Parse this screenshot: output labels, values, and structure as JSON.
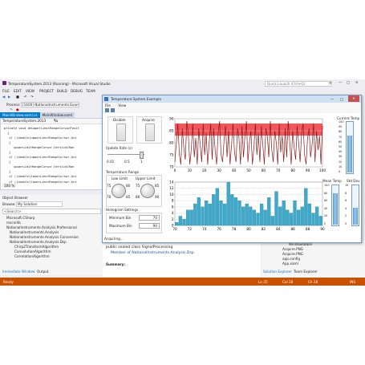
{
  "vs": {
    "title": "TemperatureSystem.2013 (Running) - Microsoft Visual Studio",
    "quick_launch": "Quick Launch (Ctrl+Q)",
    "menu": [
      "FILE",
      "EDIT",
      "VIEW",
      "PROJECT",
      "BUILD",
      "DEBUG",
      "TEAM"
    ],
    "process_label": "Process:",
    "process_value": "[1600] NationalInstruments.Example",
    "tabs": [
      "MainWindow.xaml.cs",
      "MainWindow.xaml"
    ],
    "class_dropdown": "TemperatureSystem.2013",
    "member_dropdown": "¶a",
    "code": [
      "private void OnUpperLimitRangeCursorPosit",
      "{",
      "if ((double)upperLimitRangeCursor.Act",
      "{",
      "upperLimitRangeCursor.VerticalRan",
      "}",
      "if ((double)upperLimitRangeCursor.Act",
      "{",
      "upperLimitRangeCursor.VerticalRan",
      "}",
      "if ((double)lowerLimitRangeCursor.Act",
      "if ((double)lowerLimitRangeCursor.Act"
    ],
    "zoom": "100 %",
    "object_browser": {
      "title": "Object Browser",
      "browse_label": "Browse:",
      "browse_value": "My Solution",
      "search": "<Search>",
      "items": [
        "Microsoft.CSharp",
        "mscorlib",
        "NationalInstruments.Analysis.Professional",
        "NationalInstruments.Analysis",
        "NationalInstruments.Analysis.Conversion",
        "NationalInstruments.Analysis.Dsp",
        "Chirp2TransformAlgorithm",
        "ConvolutionAlgorithm",
        "CorrelationAlgorithm"
      ],
      "detail_declaration": "public sealed class SignalProcessing",
      "detail_member": "Member of NationalInstruments.Analysis.Dsp",
      "detail_summary": "Summary:"
    },
    "bottom_tabs": [
      "Immediate Window",
      "Output"
    ],
    "solution": {
      "items": [
        "WindowsBase",
        "Acquire.PNG",
        "Acquire.PNG",
        "app.config",
        "App.xaml"
      ],
      "tabs": [
        "Solution Explorer",
        "Team Explorer"
      ]
    },
    "status": {
      "ready": "Ready",
      "ln": "Ln 25",
      "col": "Col 28",
      "ch": "Ch 28",
      "ins": "INS"
    }
  },
  "window": {
    "title": "Temperature System Example",
    "menu": [
      "File",
      "View"
    ],
    "disable_label": "Disable",
    "acquire_label": "Acquire",
    "update_rate_label": "Update Rate (s)",
    "slider_ticks": [
      "0.01",
      "0.5",
      "1"
    ],
    "temp_range_label": "Temperature Range",
    "low_limit_label": "Low Limit",
    "upper_limit_label": "Upper Limit",
    "low_knob_ticks": [
      "75",
      "80",
      "70",
      "85"
    ],
    "upper_knob_ticks": [
      "75",
      "85",
      "80",
      "90"
    ],
    "hist_settings_label": "Histogram Settings",
    "min_bin_label": "Minimum Bin",
    "min_bin_value": "70",
    "max_bin_label": "Maximum Bin",
    "max_bin_value": "90",
    "status": "Acquiring...",
    "current_temp_label": "Current Temp",
    "mean_temp_label": "Mean Temp",
    "std_dev_label": "Std Dev",
    "current_temp_ticks": [
      "100",
      "90",
      "80",
      "70",
      "60",
      "50",
      "40",
      "30",
      "20",
      "10",
      "0"
    ],
    "mean_temp_ticks": [
      "100",
      "80",
      "60",
      "40",
      "20",
      "0"
    ],
    "std_dev_ticks": [
      "10",
      "8",
      "6",
      "4",
      "2",
      "0"
    ],
    "current_temp_level": 0.72,
    "mean_temp_level": 0.78,
    "std_dev_level": 0.42
  },
  "chart_data": [
    {
      "type": "line",
      "x_ticks": [
        "0",
        "10",
        "20",
        "30",
        "40",
        "50",
        "60",
        "70",
        "80",
        "90",
        "100"
      ],
      "y_ticks": [
        "70",
        "75",
        "80",
        "85",
        "90"
      ],
      "ylim": [
        70,
        90
      ],
      "xlim": [
        0,
        100
      ],
      "band": [
        83,
        88
      ],
      "series": [
        {
          "values": [
            72,
            80,
            88,
            75,
            71,
            86,
            78,
            73,
            89,
            84,
            71,
            77,
            88,
            74,
            82,
            71,
            86,
            79,
            72,
            88,
            75,
            84,
            71,
            80,
            88,
            73,
            86,
            77,
            71,
            84,
            89,
            75,
            72,
            81,
            87,
            74,
            85,
            71,
            79,
            88,
            76,
            72,
            86,
            82,
            71,
            87,
            74,
            83,
            89,
            72,
            80,
            85,
            71,
            78,
            88,
            75,
            84,
            72,
            87,
            79,
            71,
            86,
            83,
            74,
            89,
            77,
            72,
            85,
            80,
            71,
            88,
            76,
            83,
            72,
            86,
            74,
            89,
            81,
            71,
            85,
            78,
            73,
            87,
            80,
            72,
            84,
            88,
            75,
            71,
            82,
            86,
            74,
            79,
            88,
            72,
            85,
            77,
            83,
            71,
            87
          ]
        }
      ]
    },
    {
      "type": "bar",
      "x_ticks": [
        "70",
        "72",
        "74",
        "76",
        "78",
        "80",
        "82",
        "84",
        "86",
        "88",
        "90"
      ],
      "y_ticks": [
        "0",
        "2",
        "4",
        "6",
        "8",
        "10",
        "12",
        "14"
      ],
      "ylim": [
        0,
        14
      ],
      "xlim": [
        70,
        90
      ],
      "values": [
        1,
        3,
        2,
        5,
        5,
        7,
        9,
        6,
        8,
        7,
        10,
        12,
        8,
        7,
        14,
        10,
        9,
        8,
        6,
        7,
        6,
        5,
        4,
        7,
        5,
        9,
        3,
        11,
        6,
        8,
        5,
        4,
        8,
        5,
        6,
        12,
        7,
        4,
        6,
        3
      ]
    }
  ]
}
